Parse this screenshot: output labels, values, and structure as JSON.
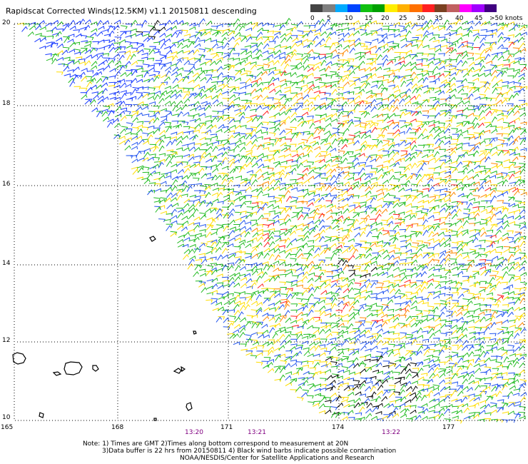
{
  "title": "Rapidscat Corrected Winds(12.5KM) v1.1 20150811 descending",
  "legend": {
    "colors": [
      "#444444",
      "#7f7f7f",
      "#00aaff",
      "#0044ff",
      "#10c010",
      "#00a000",
      "#ffee00",
      "#ffb000",
      "#ff7000",
      "#ff2020",
      "#7a4020",
      "#c06060",
      "#ff00ff",
      "#a000ff",
      "#400080"
    ],
    "labels": [
      "0",
      "5",
      "10",
      "15",
      "20",
      "25",
      "30",
      "35",
      "40",
      "45",
      ">50 knots"
    ]
  },
  "map": {
    "lat_labels": [
      "20",
      "18",
      "16",
      "14",
      "12",
      "10"
    ],
    "lon_labels": [
      "165",
      "168",
      "171",
      "174",
      "177"
    ],
    "time_labels": [
      "13:20",
      "13:21",
      "13:22"
    ],
    "barb_colors": {
      "calm": "#1a3cff",
      "light": "#2255ee",
      "moderate": "#22bb22",
      "fresh": "#ffdd00",
      "strong": "#ff8800",
      "gale": "#ff2020",
      "contaminated": "#000000"
    }
  },
  "notes": [
    "Note: 1) Times are GMT 2)Times along bottom correspond to measurement at 20N",
    "3)Data buffer is 22 hrs from 20150811 4) Black wind barbs indicate possible contamination",
    "NOAA/NESDIS/Center for Satellite Applications and Research"
  ]
}
